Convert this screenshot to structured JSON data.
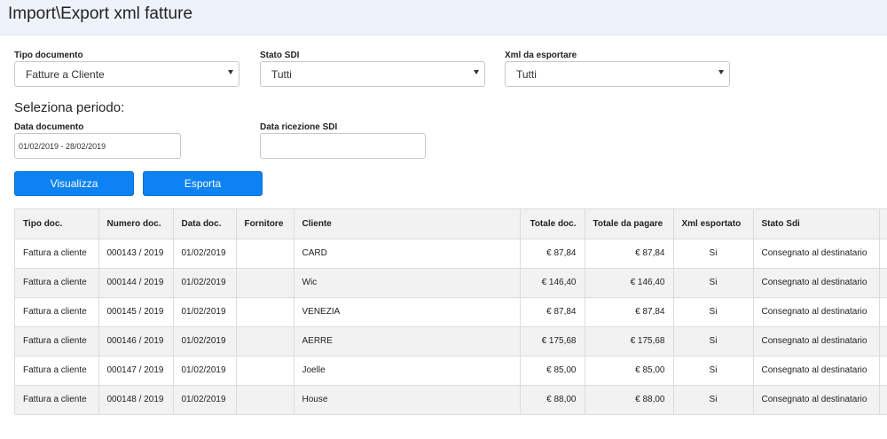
{
  "header": {
    "title": "Import\\Export xml fatture"
  },
  "filters": {
    "tipo_documento": {
      "label": "Tipo documento",
      "value": "Fatture a Cliente"
    },
    "stato_sdi": {
      "label": "Stato SDI",
      "value": "Tutti"
    },
    "xml_da_esportare": {
      "label": "Xml da esportare",
      "value": "Tutti"
    }
  },
  "period": {
    "title": "Seleziona periodo:",
    "data_documento": {
      "label": "Data documento",
      "value": "01/02/2019 - 28/02/2019"
    },
    "data_ricezione": {
      "label": "Data ricezione SDI",
      "value": ""
    }
  },
  "buttons": {
    "visualizza": "Visualizza",
    "esporta": "Esporta"
  },
  "table": {
    "headers": [
      "Tipo doc.",
      "Numero doc.",
      "Data doc.",
      "Fornitore",
      "Cliente",
      "Totale doc.",
      "Totale da pagare",
      "Xml esportato",
      "Stato Sdi"
    ],
    "rows": [
      [
        "Fattura a cliente",
        "000143 / 2019",
        "01/02/2019",
        "",
        "CARD",
        "€ 87,84",
        "€ 87,84",
        "Si",
        "Consegnato al destinatario"
      ],
      [
        "Fattura a cliente",
        "000144 / 2019",
        "01/02/2019",
        "",
        "Wic",
        "€ 146,40",
        "€ 146,40",
        "Si",
        "Consegnato al destinatario"
      ],
      [
        "Fattura a cliente",
        "000145 / 2019",
        "01/02/2019",
        "",
        "VENEZIA",
        "€ 87,84",
        "€ 87,84",
        "Si",
        "Consegnato al destinatario"
      ],
      [
        "Fattura a cliente",
        "000146 / 2019",
        "01/02/2019",
        "",
        "AERRE",
        "€ 175,68",
        "€ 175,68",
        "Si",
        "Consegnato al destinatario"
      ],
      [
        "Fattura a cliente",
        "000147 / 2019",
        "01/02/2019",
        "",
        "Joelle",
        "€ 85,00",
        "€ 85,00",
        "Si",
        "Consegnato al destinatario"
      ],
      [
        "Fattura a cliente",
        "000148 / 2019",
        "01/02/2019",
        "",
        "House",
        "€ 88,00",
        "€ 88,00",
        "Si",
        "Consegnato al destinatario"
      ]
    ]
  },
  "colors": {
    "accent": "#0d82f2",
    "topbar": "#eef3fb"
  }
}
